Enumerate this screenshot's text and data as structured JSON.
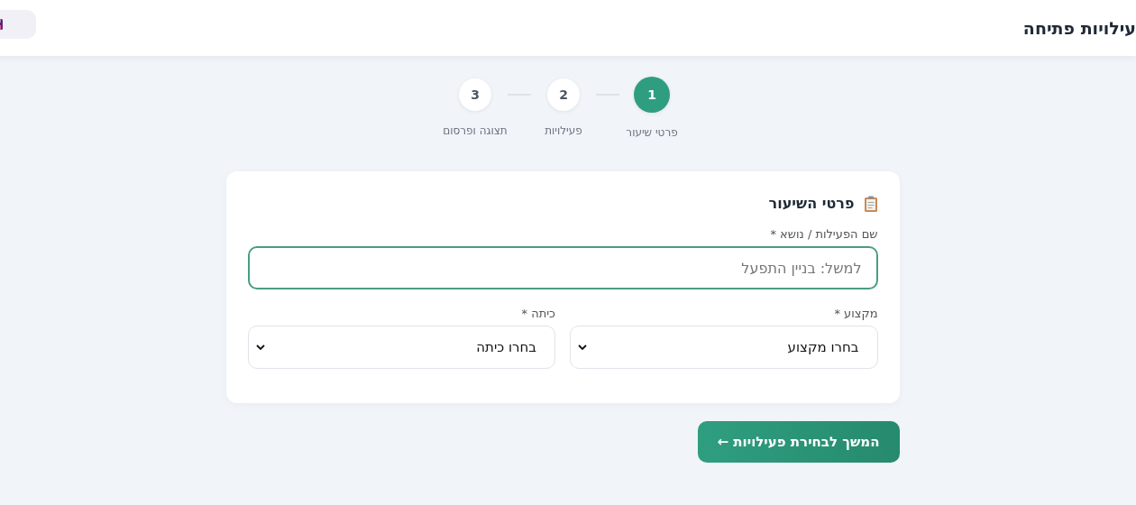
{
  "header": {
    "title": "עילויות פתיחה"
  },
  "steps": [
    {
      "number": "1",
      "label": "פרטי שיעור",
      "selected": true
    },
    {
      "number": "2",
      "label": "פעילויות",
      "selected": false
    },
    {
      "number": "3",
      "label": "תצוגה ופרסום",
      "selected": false
    }
  ],
  "card": {
    "title": "פרטי השיעור",
    "topic": {
      "label": "שם הפעילות / נושא *",
      "placeholder": "למשל: בניין התפעל"
    },
    "selects": [
      {
        "label": "מקצוע *",
        "value": "בחרו מקצוע"
      },
      {
        "label": "כיתה *",
        "value": "בחרו כיתה"
      }
    ]
  },
  "continue_button": "המשך לבחירת פעילויות ←"
}
